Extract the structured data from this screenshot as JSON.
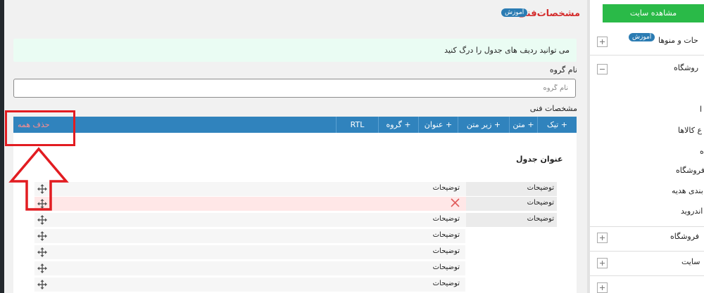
{
  "main": {
    "title": "مشخصات‌فنی",
    "tutorial_badge": "آموزش",
    "info_text": "می توانید ردیف های جدول را درگ کنید",
    "group_label": "نام گروه",
    "group_placeholder": "نام گروه",
    "specs_label": "مشخصات فنی",
    "toolbar": {
      "buttons": [
        "+ تیک",
        "+ متن",
        "+ زیر متن",
        "+ عنوان",
        "+ گروه",
        "RTL"
      ],
      "delete_all": "حذف همه"
    },
    "table_title": "عنوان جدول",
    "rows": [
      {
        "left": "توضیحات",
        "right": "توضیحات"
      },
      {
        "left": "",
        "right": "توضیحات"
      },
      {
        "left": "توضیحات",
        "right": "توضیحات"
      },
      {
        "left": "توضیحات",
        "right": ""
      },
      {
        "left": "توضیحات",
        "right": ""
      },
      {
        "left": "توضیحات",
        "right": ""
      },
      {
        "left": "توضیحات",
        "right": ""
      }
    ]
  },
  "sidebar": {
    "view_site_button": "مشاهده سایت",
    "tutorial_badge": "آموزش",
    "items": [
      "حات و منوها",
      "روشگاه",
      "ا",
      "ع کالاها",
      "ه",
      "فروشگاه",
      "بندی هدیه",
      "اندروید",
      "فروشگاه",
      "سایت"
    ]
  },
  "colors": {
    "accent_blue": "#3083bd",
    "green": "#2aba48",
    "title_red": "#d42c2c",
    "annotation_red": "#e21c21"
  }
}
